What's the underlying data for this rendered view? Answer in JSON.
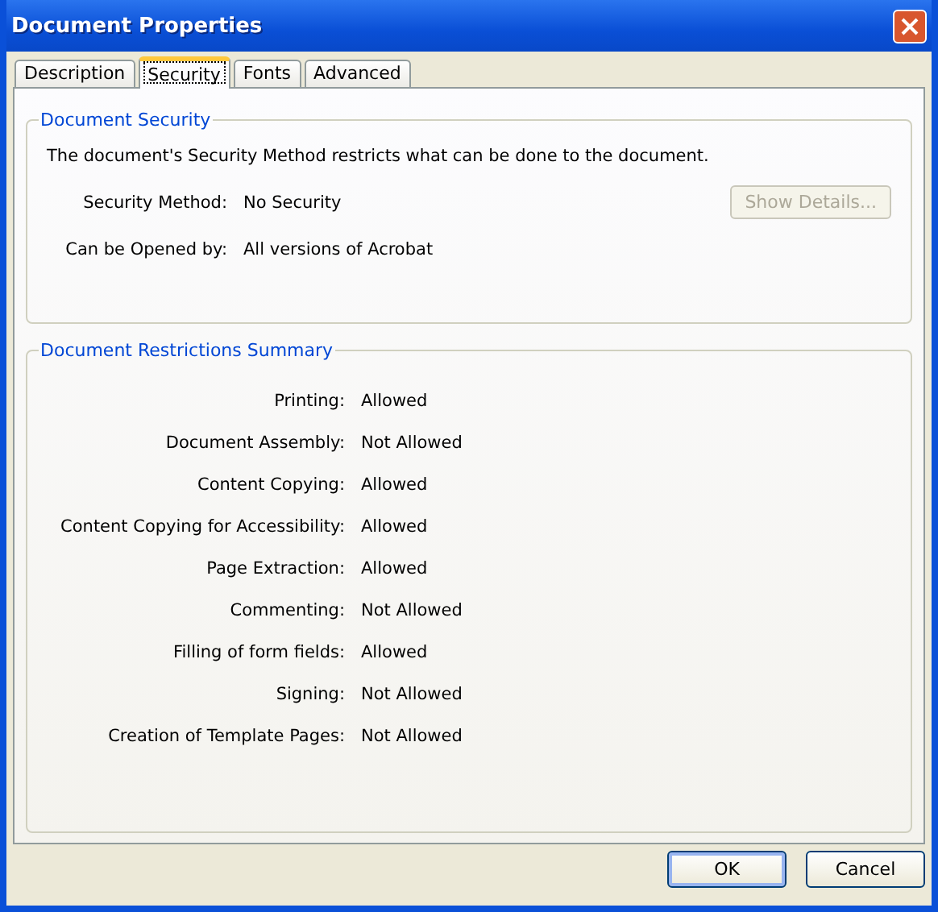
{
  "window": {
    "title": "Document Properties"
  },
  "tabs": [
    {
      "label": "Description",
      "selected": false
    },
    {
      "label": "Security",
      "selected": true
    },
    {
      "label": "Fonts",
      "selected": false
    },
    {
      "label": "Advanced",
      "selected": false
    }
  ],
  "document_security": {
    "title": "Document Security",
    "description": "The document's Security Method restricts what can be done to the document.",
    "fields": [
      {
        "label": "Security Method:",
        "value": "No Security"
      },
      {
        "label": "Can be Opened by:",
        "value": "All versions of Acrobat"
      }
    ],
    "show_details_button": {
      "label": "Show Details...",
      "disabled": true
    }
  },
  "restrictions": {
    "title": "Document Restrictions Summary",
    "rows": [
      {
        "label": "Printing:",
        "value": "Allowed"
      },
      {
        "label": "Document Assembly:",
        "value": "Not Allowed"
      },
      {
        "label": "Content Copying:",
        "value": "Allowed"
      },
      {
        "label": "Content Copying for Accessibility:",
        "value": "Allowed"
      },
      {
        "label": "Page Extraction:",
        "value": "Allowed"
      },
      {
        "label": "Commenting:",
        "value": "Not Allowed"
      },
      {
        "label": "Filling of form fields:",
        "value": "Allowed"
      },
      {
        "label": "Signing:",
        "value": "Not Allowed"
      },
      {
        "label": "Creation of Template Pages:",
        "value": "Not Allowed"
      }
    ]
  },
  "buttons": [
    "OK",
    "Cancel"
  ]
}
